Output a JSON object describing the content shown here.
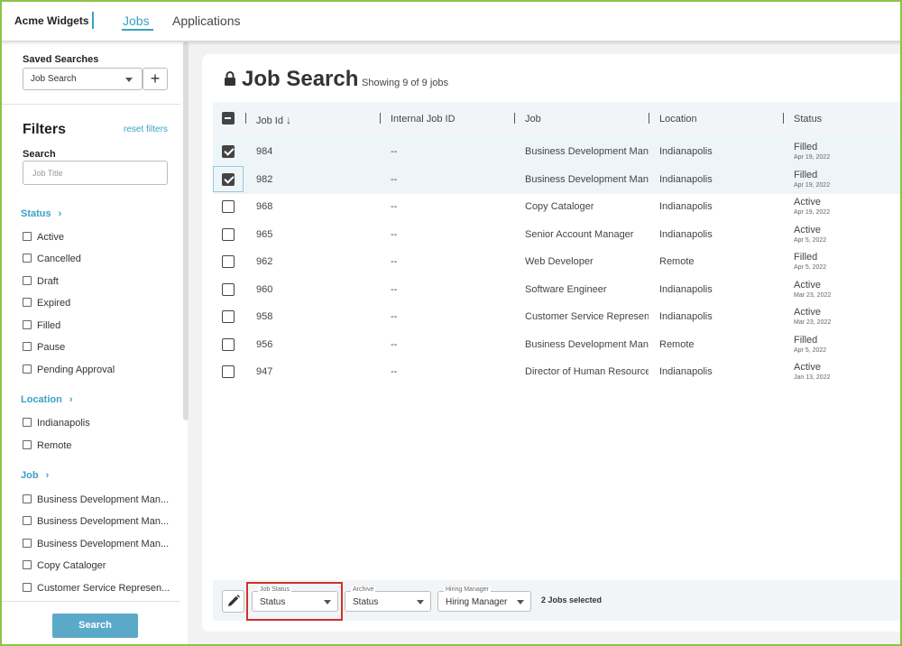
{
  "topbar": {
    "brand": "Acme Widgets",
    "tabs": [
      {
        "label": "Jobs",
        "active": true
      },
      {
        "label": "Applications",
        "active": false
      }
    ]
  },
  "sidebar": {
    "saved_searches_label": "Saved Searches",
    "saved_search_value": "Job Search",
    "add_label": "+",
    "filters_title": "Filters",
    "reset_label": "reset filters",
    "search_label": "Search",
    "search_placeholder": "Job Title",
    "sections": {
      "status": {
        "title": "Status",
        "options": [
          "Active",
          "Cancelled",
          "Draft",
          "Expired",
          "Filled",
          "Pause",
          "Pending Approval"
        ]
      },
      "location": {
        "title": "Location",
        "options": [
          "Indianapolis",
          "Remote"
        ]
      },
      "job": {
        "title": "Job",
        "options": [
          "Business Development Man...",
          "Business Development Man...",
          "Business Development Man...",
          "Copy Cataloger",
          "Customer Service Represen..."
        ]
      }
    },
    "search_button": "Search"
  },
  "main": {
    "title": "Job Search",
    "showing": "Showing 9 of 9 jobs",
    "columns": [
      "Job Id",
      "Internal Job ID",
      "Job",
      "Location",
      "Status"
    ],
    "rows": [
      {
        "id": "984",
        "internal": "--",
        "job": "Business Development Manager",
        "location": "Indianapolis",
        "status": "Filled",
        "date": "Apr 19, 2022",
        "checked": true
      },
      {
        "id": "982",
        "internal": "--",
        "job": "Business Development Manager",
        "location": "Indianapolis",
        "status": "Filled",
        "date": "Apr 19, 2022",
        "checked": true
      },
      {
        "id": "968",
        "internal": "--",
        "job": "Copy Cataloger",
        "location": "Indianapolis",
        "status": "Active",
        "date": "Apr 19, 2022",
        "checked": false
      },
      {
        "id": "965",
        "internal": "--",
        "job": "Senior Account Manager",
        "location": "Indianapolis",
        "status": "Active",
        "date": "Apr 5, 2022",
        "checked": false
      },
      {
        "id": "962",
        "internal": "--",
        "job": "Web Developer",
        "location": "Remote",
        "status": "Filled",
        "date": "Apr 5, 2022",
        "checked": false
      },
      {
        "id": "960",
        "internal": "--",
        "job": "Software Engineer",
        "location": "Indianapolis",
        "status": "Active",
        "date": "Mar 23, 2022",
        "checked": false
      },
      {
        "id": "958",
        "internal": "--",
        "job": "Customer Service Representative",
        "location": "Indianapolis",
        "status": "Active",
        "date": "Mar 23, 2022",
        "checked": false
      },
      {
        "id": "956",
        "internal": "--",
        "job": "Business Development Manager",
        "location": "Remote",
        "status": "Filled",
        "date": "Apr 5, 2022",
        "checked": false
      },
      {
        "id": "947",
        "internal": "--",
        "job": "Director of Human Resources",
        "location": "Indianapolis",
        "status": "Active",
        "date": "Jan 13, 2022",
        "checked": false
      }
    ]
  },
  "actionbar": {
    "job_status": {
      "legend": "Job Status",
      "value": "Status"
    },
    "archive": {
      "legend": "Archive",
      "value": "Status"
    },
    "hiring_manager": {
      "legend": "Hiring Manager",
      "value": "Hiring Manager"
    },
    "selected_text": "2 Jobs selected"
  },
  "colors": {
    "accent": "#3aa1c6",
    "frame": "#8bc34a",
    "highlight": "#d32f2f",
    "button": "#5ba9c9"
  }
}
